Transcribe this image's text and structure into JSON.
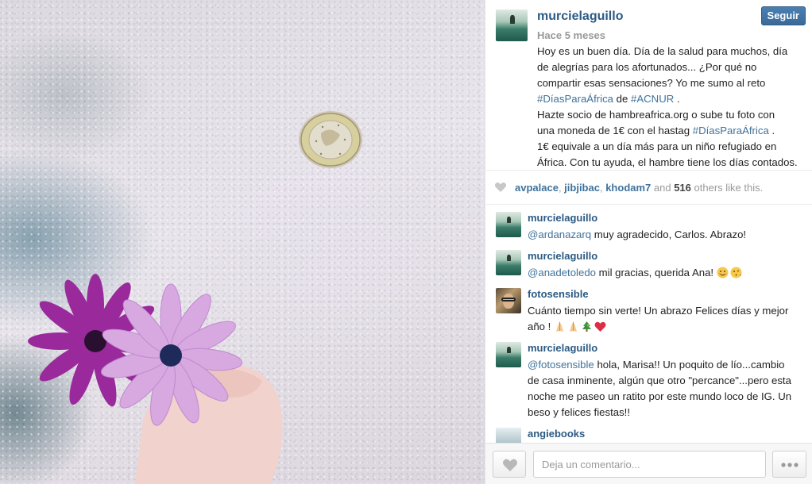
{
  "post": {
    "username": "murcielaguillo",
    "time": "Hace 5 meses",
    "follow_label": "Seguir",
    "caption_lines": [
      {
        "pre": "Hoy es un buen día. Día de la salud para muchos, día",
        "tag1": "",
        "mid": "",
        "tag2": "",
        "post": ""
      },
      {
        "pre": "de alegrías para los afortunados... ¿Por qué no",
        "tag1": "",
        "mid": "",
        "tag2": "",
        "post": ""
      },
      {
        "pre": "compartir esas sensaciones? Yo me sumo al reto",
        "tag1": "",
        "mid": "",
        "tag2": "",
        "post": ""
      },
      {
        "pre": "",
        "tag1": "#DíasParaÁfrica",
        "mid": " de ",
        "tag2": "#ACNUR",
        "post": " ."
      },
      {
        "pre": "Hazte socio de hambreafrica.org o sube tu foto con",
        "tag1": "",
        "mid": "",
        "tag2": "",
        "post": ""
      },
      {
        "pre": "una moneda de 1€ con el hastag ",
        "tag1": "#DíasParaÁfrica",
        "mid": " .",
        "tag2": "",
        "post": ""
      },
      {
        "pre": "1€ equivale a un día más para un niño refugiado en",
        "tag1": "",
        "mid": "",
        "tag2": "",
        "post": ""
      },
      {
        "pre": "África. Con tu ayuda, el hambre tiene los días contados.",
        "tag1": "",
        "mid": "",
        "tag2": "",
        "post": ""
      }
    ]
  },
  "likes": {
    "users": [
      "avpalace",
      "jibjibac",
      "khodam7"
    ],
    "sep": ", ",
    "and": " and ",
    "count": "516",
    "suffix": " others like this."
  },
  "comments": [
    {
      "user": "murcielaguillo",
      "avatar": "sea",
      "lines": [
        {
          "mention": "@ardanazarq",
          "text": " muy agradecido, Carlos. Abrazo!"
        }
      ],
      "emoji": []
    },
    {
      "user": "murcielaguillo",
      "avatar": "sea",
      "lines": [
        {
          "mention": "@anadetoledo",
          "text": " mil gracias, querida Ana! "
        }
      ],
      "emoji": [
        "smiling-face-emoji",
        "kissing-face-emoji"
      ]
    },
    {
      "user": "fotosensible",
      "avatar": "dark",
      "lines": [
        {
          "mention": "",
          "text": "Cuánto tiempo sin verte! Un abrazo Felices días y mejor"
        },
        {
          "mention": "",
          "text": "año ! "
        }
      ],
      "emoji": [
        "praying-hands-emoji",
        "praying-hands-emoji",
        "christmas-tree-emoji",
        "red-heart-emoji"
      ]
    },
    {
      "user": "murcielaguillo",
      "avatar": "sea",
      "lines": [
        {
          "mention": "@fotosensible",
          "text": " hola, Marisa!! Un poquito de lío...cambio"
        },
        {
          "mention": "",
          "text": "de casa inminente, algún que otro \"percance\"...pero esta"
        },
        {
          "mention": "",
          "text": "noche me paseo un ratito por este mundo loco de IG. Un"
        },
        {
          "mention": "",
          "text": "beso y felices fiestas!!"
        }
      ],
      "emoji": []
    },
    {
      "user": "angiebooks",
      "avatar": "water",
      "lines": [],
      "emoji": []
    }
  ],
  "footer": {
    "comment_placeholder": "Deja un comentario..."
  },
  "colors": {
    "link": "#3f729b",
    "username": "#2b5a83",
    "follow_button": "#3a6a99",
    "muted": "#999999"
  },
  "icons": [
    "heart-icon",
    "like-heart-icon",
    "more-options-icon"
  ]
}
